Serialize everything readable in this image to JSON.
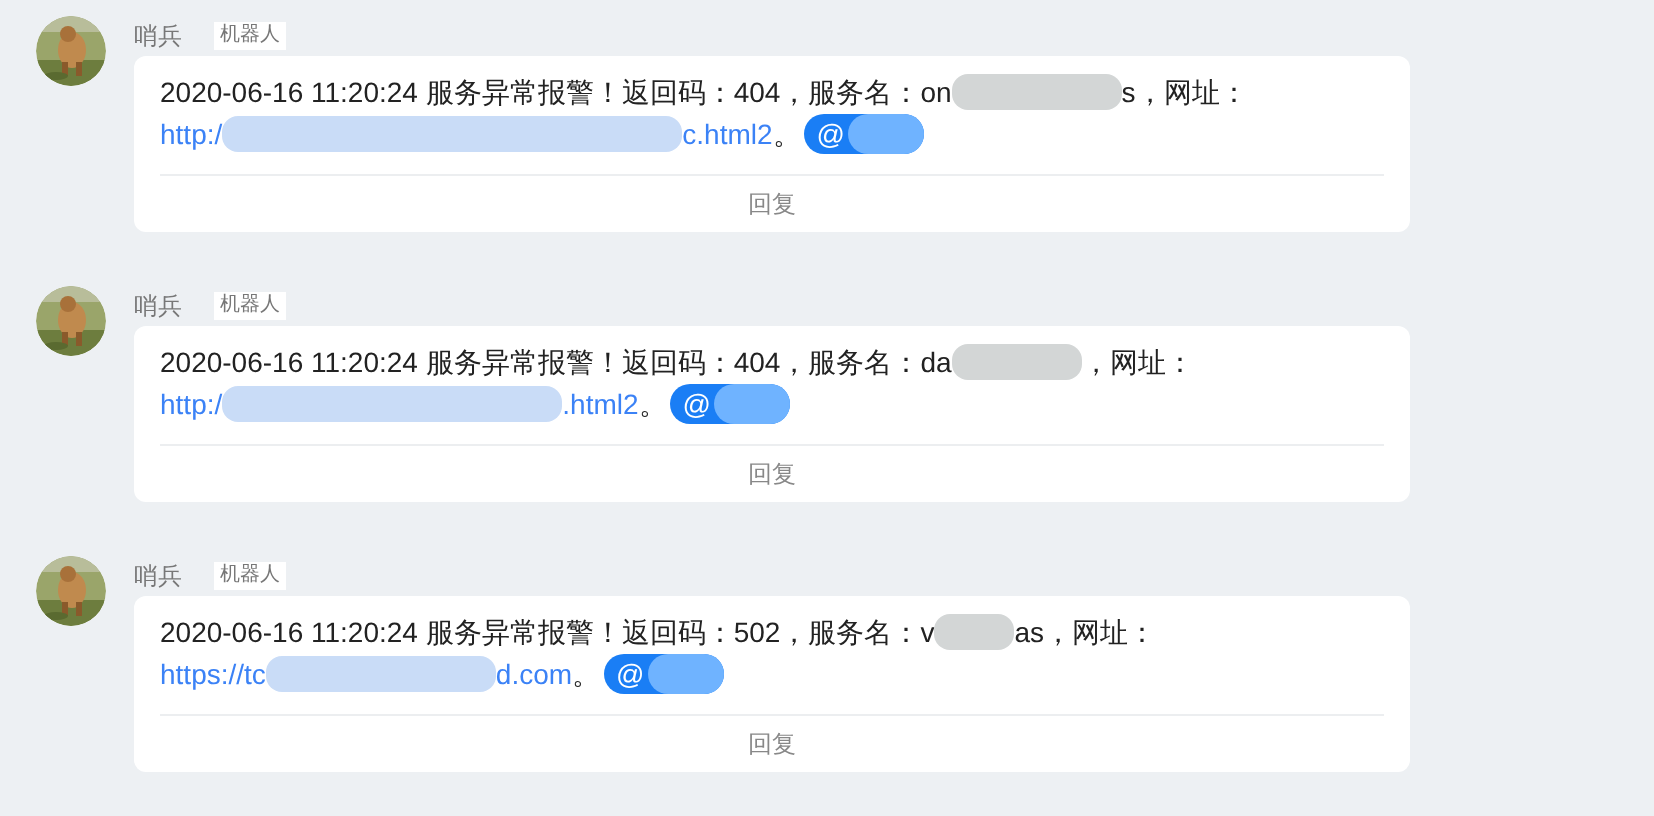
{
  "messages": [
    {
      "sender": "哨兵",
      "tag": "机器人",
      "segments": [
        {
          "kind": "text",
          "text": "2020-06-16 11:20:24 服务异常报警！返回码：404，服务名：on"
        },
        {
          "kind": "redacted"
        },
        {
          "kind": "text",
          "text": "s，网址："
        },
        {
          "kind": "break"
        },
        {
          "kind": "link",
          "text": "http:/"
        },
        {
          "kind": "redacted"
        },
        {
          "kind": "link",
          "text": "c.html2"
        },
        {
          "kind": "text",
          "text": "。"
        },
        {
          "kind": "mention",
          "text": "@"
        }
      ],
      "reply": "回复"
    },
    {
      "sender": "哨兵",
      "tag": "机器人",
      "segments": [
        {
          "kind": "text",
          "text": "2020-06-16 11:20:24 服务异常报警！返回码：404，服务名：da"
        },
        {
          "kind": "redacted"
        },
        {
          "kind": "text",
          "text": "，网址："
        },
        {
          "kind": "break"
        },
        {
          "kind": "link",
          "text": "http:/"
        },
        {
          "kind": "redacted"
        },
        {
          "kind": "link",
          "text": ".html2"
        },
        {
          "kind": "text",
          "text": "。"
        },
        {
          "kind": "mention",
          "text": "@"
        }
      ],
      "reply": "回复"
    },
    {
      "sender": "哨兵",
      "tag": "机器人",
      "segments": [
        {
          "kind": "text",
          "text": "2020-06-16 11:20:24 服务异常报警！返回码：502，服务名：v"
        },
        {
          "kind": "redacted"
        },
        {
          "kind": "text",
          "text": "as，网址："
        },
        {
          "kind": "break"
        },
        {
          "kind": "link",
          "text": "https://tc"
        },
        {
          "kind": "redacted"
        },
        {
          "kind": "link",
          "text": "d.com"
        },
        {
          "kind": "text",
          "text": "。"
        },
        {
          "kind": "mention",
          "text": "@"
        }
      ],
      "reply": "回复"
    }
  ]
}
